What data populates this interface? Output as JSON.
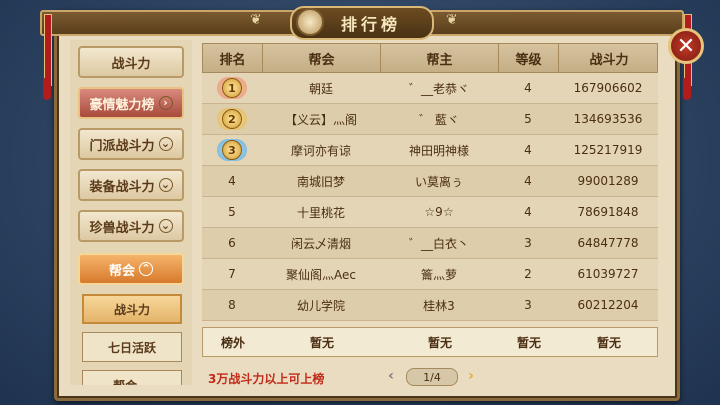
{
  "title": "排行榜",
  "nav": {
    "items": [
      {
        "label": "战斗力",
        "chevron": false
      },
      {
        "label": "豪情魅力榜",
        "chevron": true
      },
      {
        "label": "门派战斗力",
        "chevron": true
      },
      {
        "label": "装备战斗力",
        "chevron": true
      },
      {
        "label": "珍兽战斗力",
        "chevron": true
      },
      {
        "label": "帮会",
        "chevron": true
      }
    ],
    "sub_items": [
      {
        "label": "战斗力"
      },
      {
        "label": "七日活跃"
      },
      {
        "label": "帮会..."
      }
    ]
  },
  "table": {
    "headers": [
      "排名",
      "帮会",
      "帮主",
      "等级",
      "战斗力"
    ],
    "rows": [
      {
        "rank": "1",
        "guild": "朝廷",
        "leader": "゛__老恭ヾ",
        "level": "4",
        "power": "167906602"
      },
      {
        "rank": "2",
        "guild": "【义云】灬阁",
        "leader": "゛ 藍ヾ",
        "level": "5",
        "power": "134693536"
      },
      {
        "rank": "3",
        "guild": "摩诃亦有谅",
        "leader": "神田明神様",
        "level": "4",
        "power": "125217919"
      },
      {
        "rank": "4",
        "guild": "南城旧梦",
        "leader": "い莫离ぅ",
        "level": "4",
        "power": "99001289"
      },
      {
        "rank": "5",
        "guild": "十里桃花",
        "leader": "☆9☆",
        "level": "4",
        "power": "78691848"
      },
      {
        "rank": "6",
        "guild": "闲云乄清烟",
        "leader": "゛__白衣丶",
        "level": "3",
        "power": "64847778"
      },
      {
        "rank": "7",
        "guild": "聚仙阁灬Aec",
        "leader": "籥灬萝",
        "level": "2",
        "power": "61039727"
      },
      {
        "rank": "8",
        "guild": "幼儿学院",
        "leader": "桂林3",
        "level": "3",
        "power": "60212204"
      }
    ]
  },
  "my_row": {
    "rank": "榜外",
    "guild": "暂无",
    "leader": "暂无",
    "level": "暂无",
    "power": "暂无"
  },
  "footer": {
    "note": "3万战斗力以上可上榜"
  },
  "pager": {
    "text": "1/4",
    "prev": "‹",
    "next": "›"
  },
  "close": "✕"
}
